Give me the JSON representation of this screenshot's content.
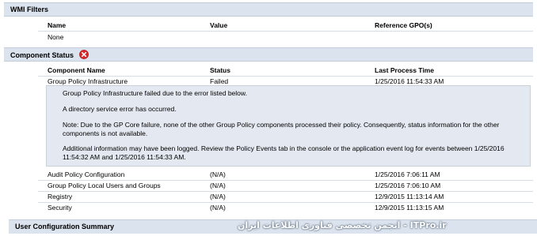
{
  "wmi_filters": {
    "title": "WMI Filters",
    "columns": [
      "Name",
      "Value",
      "Reference GPO(s)"
    ],
    "rows": [
      [
        "None",
        "",
        ""
      ]
    ]
  },
  "component_status": {
    "title": "Component Status",
    "status_icon": "error-x-icon",
    "columns": [
      "Component Name",
      "Status",
      "Last Process Time"
    ],
    "rows": [
      [
        "Group Policy Infrastructure",
        "Failed",
        "1/25/2016 11:54:33 AM"
      ],
      [
        "Audit Policy Configuration",
        "(N/A)",
        "1/25/2016 7:06:11 AM"
      ],
      [
        "Group Policy Local Users and Groups",
        "(N/A)",
        "1/25/2016 7:06:10 AM"
      ],
      [
        "Registry",
        "(N/A)",
        "12/9/2015 11:13:14 AM"
      ],
      [
        "Security",
        "(N/A)",
        "12/9/2015 11:13:15 AM"
      ]
    ],
    "detail": {
      "line1": "Group Policy Infrastructure failed due to the error listed below.",
      "line2": "A directory service error has occurred.",
      "line3": "Note: Due to the GP Core failure, none of the other Group Policy components processed their policy. Consequently, status information for the other",
      "line4": "components is not available.",
      "line5": "Additional information may have been logged. Review the Policy Events tab in the console or the application event log for events between 1/25/2016",
      "line6": "11:54:32 AM and 1/25/2016 11:54:33 AM."
    }
  },
  "user_config": {
    "title": "User Configuration Summary"
  },
  "watermark": {
    "text": "انجمن تخصصی فناوری اطلاعات ایران - ITPro.ir"
  },
  "colors": {
    "header_bg": "#dbe3ee",
    "detail_bg": "#e4e9f1",
    "error_red": "#d9262b"
  }
}
